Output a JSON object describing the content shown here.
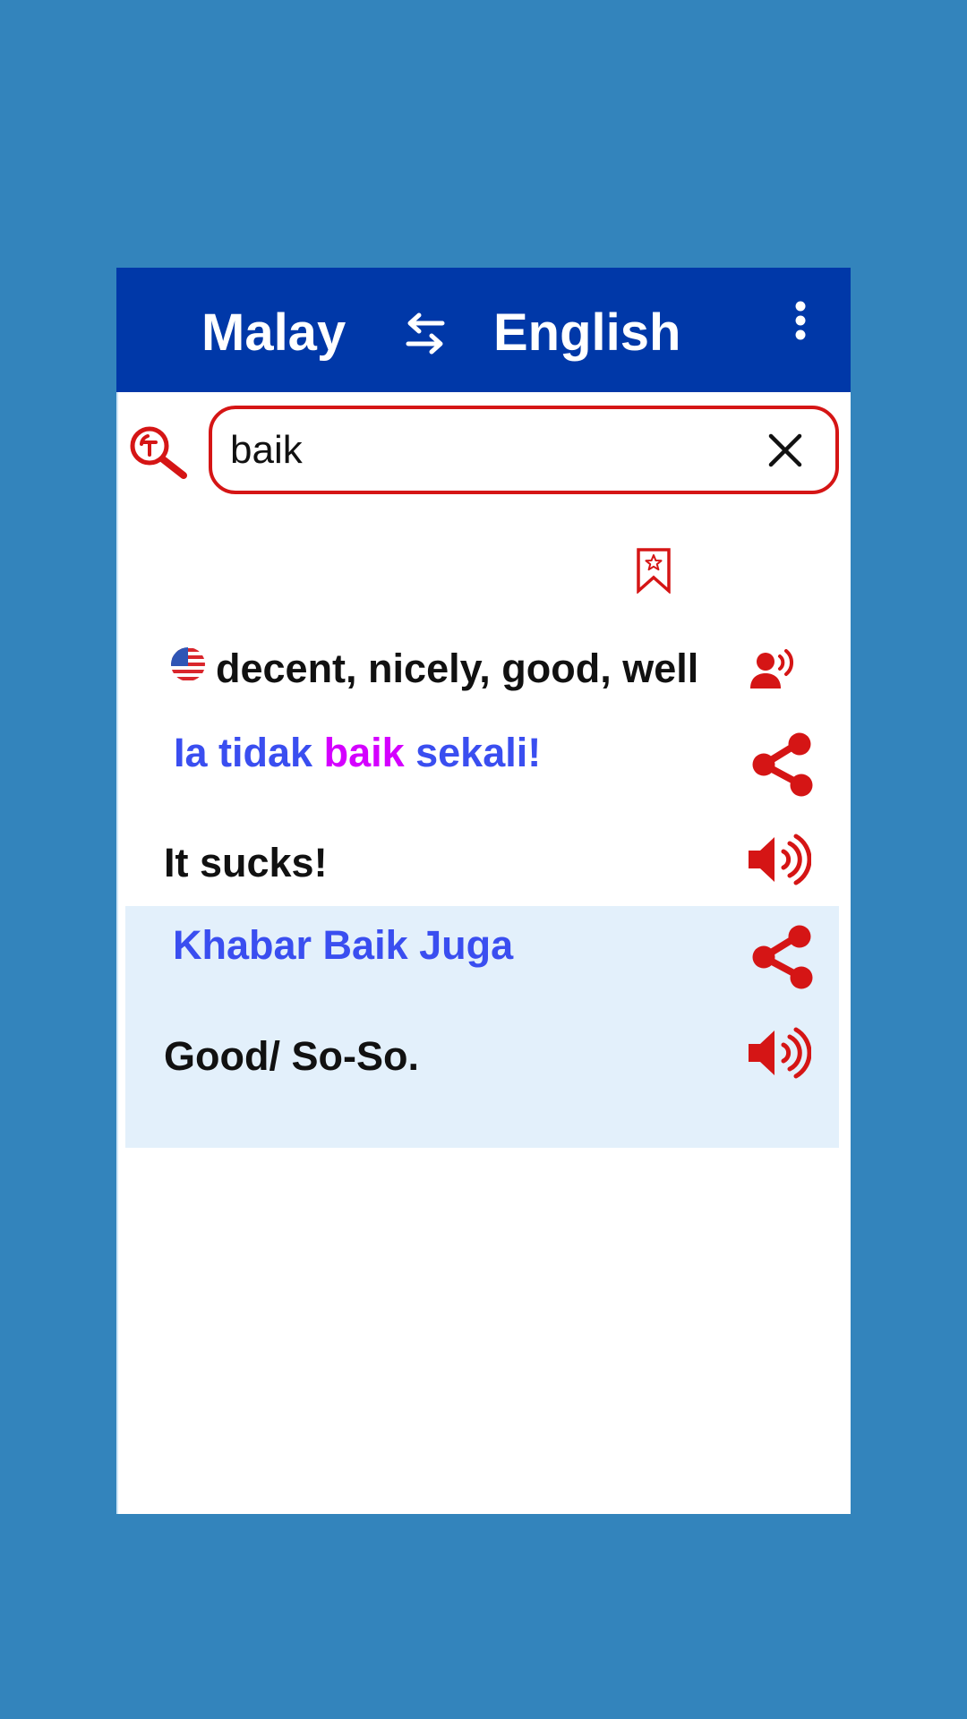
{
  "header": {
    "source_language": "Malay",
    "target_language": "English",
    "swap_icon": "swap-arrows-icon",
    "menu_icon": "more-vert-icon"
  },
  "search": {
    "icon": "text-search-icon",
    "value": "baik",
    "placeholder": "",
    "clear_icon": "close-icon"
  },
  "bookmark_icon": "bookmark-star-icon",
  "result": {
    "flag_icon": "us-flag-icon",
    "meaning": "decent, nicely, good, well",
    "pronounce_icon": "voice-person-icon"
  },
  "examples": [
    {
      "source_parts": [
        {
          "text": "Ia tidak ",
          "highlight": false
        },
        {
          "text": "baik",
          "highlight": true
        },
        {
          "text": " sekali!",
          "highlight": false
        }
      ],
      "translation": "It sucks!",
      "highlighted_row": false,
      "share_icon": "share-icon",
      "speak_icon": "speaker-icon"
    },
    {
      "source_parts": [
        {
          "text": "Khabar Baik Juga",
          "highlight": false
        }
      ],
      "translation": "Good/ So-So.",
      "highlighted_row": true,
      "share_icon": "share-icon",
      "speak_icon": "speaker-icon"
    }
  ],
  "colors": {
    "background": "#3384BC",
    "header": "#0038A8",
    "accent_red": "#D51515",
    "sentence_blue": "#3A4EF0",
    "keyword_magenta": "#D400FF",
    "row_highlight": "#E3F0FB"
  }
}
